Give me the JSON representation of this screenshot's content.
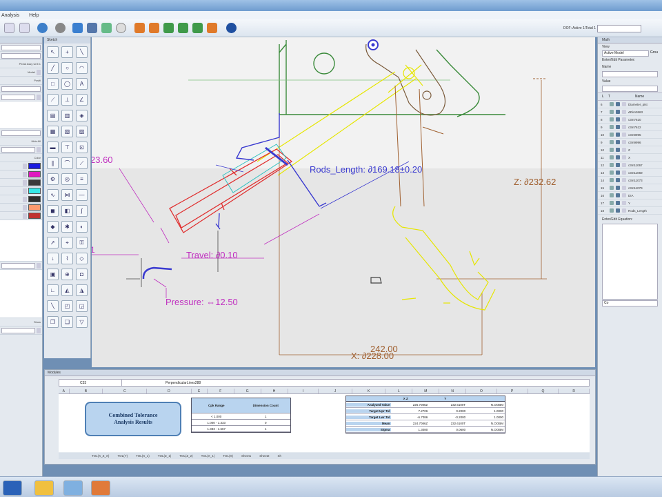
{
  "menu": {
    "items": [
      "Analysis",
      "Help"
    ]
  },
  "toolbar": {
    "dof_status": "DOF: Active 1/Total 1"
  },
  "left_panel": {
    "item_label_1": "Pedal Assy Unit 1",
    "model_select": "Model",
    "field_label": "Positi",
    "hide_all": "Hide All",
    "color_header": "Color",
    "swatches": [
      "#1a1ae0",
      "#e019c0",
      "#3a3a3a",
      "#36e8e8",
      "#2e2e2e",
      "#ff9a6e",
      "#c03030"
    ],
    "show_btn": "Show"
  },
  "sketch_palette": {
    "title": "Sketch"
  },
  "drawing": {
    "dim_left": "23.60",
    "rods_length": "Rods_Length:  ∂169.18±0.20",
    "z_dim": "Z:  ∂232.62",
    "travel": "Travel:  ∂0.10",
    "pressure": "Pressure:  ⇔12.50",
    "x_dim_upper": "242.00",
    "x_dim_lower": "X:  ∂228.00",
    "left_marker": "1",
    "colors": {
      "green": "#3a8a3a",
      "yellow": "#e6e600",
      "red": "#e03030",
      "blue": "#3a3ad0",
      "magenta": "#c030c0",
      "brown": "#a06030",
      "cyan": "#30c0c0"
    }
  },
  "right_panel": {
    "title": "Math",
    "view_label": "View",
    "active_model": "Active Model",
    "group_label": "Grou",
    "enter_param": "Enter/Edit Parameter:",
    "name_label": "Name",
    "value_label": "Value",
    "col_l": "L",
    "col_t": "T",
    "col_name": "Name",
    "rows": [
      {
        "n": "6",
        "name": "Diameter_pist"
      },
      {
        "n": "7",
        "name": "ΔDim3663"
      },
      {
        "n": "8",
        "name": "c3m7610"
      },
      {
        "n": "9",
        "name": "c3m7612"
      },
      {
        "n": "10",
        "name": "c3m9995"
      },
      {
        "n": "9",
        "name": "c3m9996"
      },
      {
        "n": "10",
        "name": "Z"
      },
      {
        "n": "11",
        "name": "X"
      },
      {
        "n": "12",
        "name": "c3m11067"
      },
      {
        "n": "13",
        "name": "c3m11069"
      },
      {
        "n": "14",
        "name": "c3m11073"
      },
      {
        "n": "15",
        "name": "c3m11079"
      },
      {
        "n": "16",
        "name": "DIA"
      },
      {
        "n": "17",
        "name": "Y"
      },
      {
        "n": "18",
        "name": "Rods_Length"
      }
    ],
    "enter_equation": "Enter/Edit Equation:",
    "eq_value": "Co"
  },
  "modules": {
    "title": "Modules",
    "cell_ref": "C33",
    "formula": "PerpendicularLines288",
    "columns": [
      "A",
      "B",
      "C",
      "D",
      "E",
      "F",
      "G",
      "H",
      "I",
      "J",
      "K",
      "L",
      "M",
      "N",
      "O",
      "P",
      "Q",
      "R"
    ],
    "rows": [
      "1",
      "2",
      "3",
      "4",
      "5",
      "6",
      "7",
      "8"
    ],
    "title_box": "Combined Tolerance\nAnalysis Results",
    "table_headers": [
      "Cpk Range",
      "Dimension Count"
    ],
    "table_rows": [
      [
        "< 1.000",
        "1"
      ],
      [
        "1.000 - 1.333",
        "0"
      ],
      [
        "1.333 - 1.667",
        "1"
      ]
    ],
    "stats_headers": [
      "",
      "X Z",
      "Y",
      ""
    ],
    "stats_rows": [
      [
        "Analyzed Value",
        "226.7086Z",
        "232.6100T",
        "N.OOBM"
      ],
      [
        "Target Upr Tol",
        "7.2706",
        "0.2000",
        "1.0000"
      ],
      [
        "Target Lwr Tol",
        "-6.7086",
        "-0.2000",
        "1.0000"
      ],
      [
        "Mean",
        "224.7086Z",
        "232.6100T",
        "N.OOBM"
      ],
      [
        "Sigma",
        "1.3080",
        "0.0600",
        "N.OOBM"
      ]
    ],
    "sheet_tabs": [
      "TOL(X_Z_X)",
      "TOL(Y)",
      "TOL(X_1)",
      "TOL(Z_1)",
      "TOL(Z_2)",
      "TOL(X_1)",
      "TOL(X)",
      "Sheet1",
      "Sheet2",
      "Sh"
    ]
  }
}
